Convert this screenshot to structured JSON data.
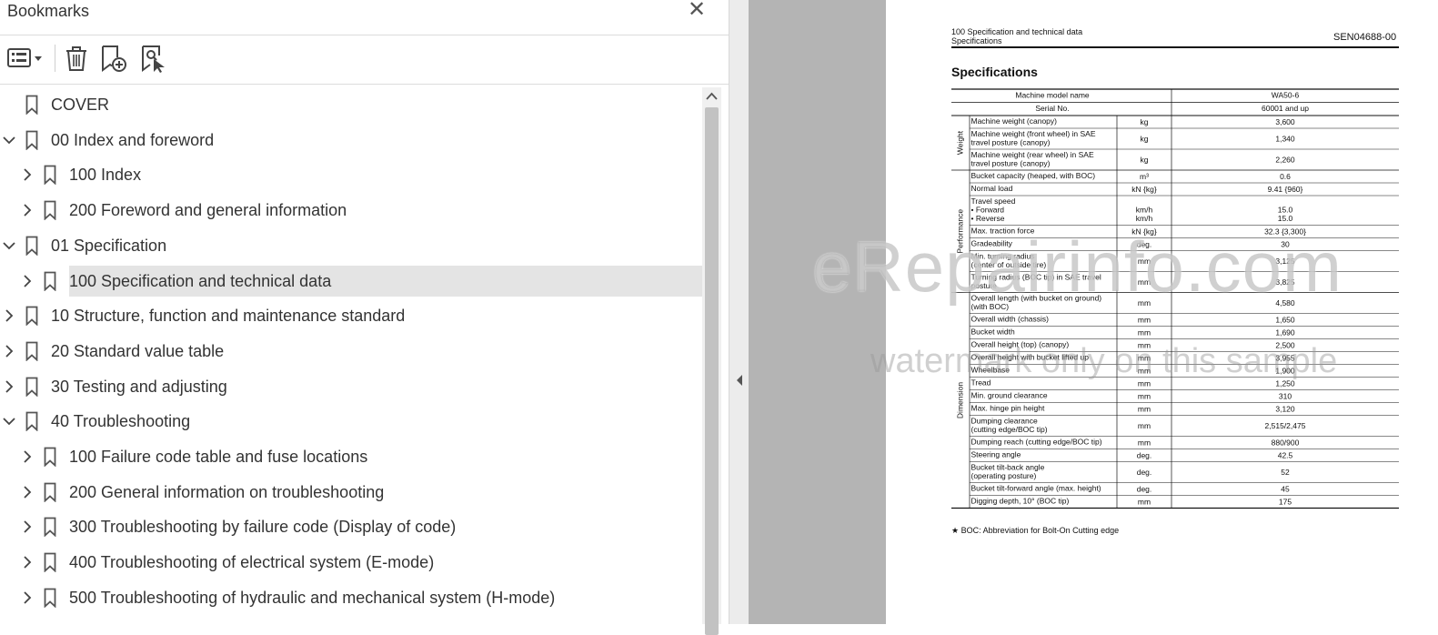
{
  "panel": {
    "title": "Bookmarks",
    "close_label": "✕"
  },
  "toolbar": {
    "options_icon": "options-list-icon",
    "delete_icon": "trash-icon",
    "new_bookmark_icon": "add-bookmark-icon",
    "bookmark_from_selection_icon": "bookmark-search-icon"
  },
  "bookmarks": [
    {
      "label": "COVER",
      "level": 0,
      "expander": "none",
      "selected": false
    },
    {
      "label": "00 Index and foreword",
      "level": 0,
      "expander": "expanded",
      "selected": false
    },
    {
      "label": "100 Index",
      "level": 1,
      "expander": "collapsed",
      "selected": false
    },
    {
      "label": "200 Foreword and general information",
      "level": 1,
      "expander": "collapsed",
      "selected": false
    },
    {
      "label": "01 Specification",
      "level": 0,
      "expander": "expanded",
      "selected": false
    },
    {
      "label": "100 Specification and technical data",
      "level": 1,
      "expander": "collapsed",
      "selected": true
    },
    {
      "label": "10 Structure, function and maintenance standard",
      "level": 0,
      "expander": "collapsed",
      "selected": false
    },
    {
      "label": "20 Standard value table",
      "level": 0,
      "expander": "collapsed",
      "selected": false
    },
    {
      "label": "30 Testing and adjusting",
      "level": 0,
      "expander": "collapsed",
      "selected": false
    },
    {
      "label": "40 Troubleshooting",
      "level": 0,
      "expander": "expanded",
      "selected": false
    },
    {
      "label": "100 Failure code table and fuse locations",
      "level": 1,
      "expander": "collapsed",
      "selected": false
    },
    {
      "label": "200 General information on troubleshooting",
      "level": 1,
      "expander": "collapsed",
      "selected": false
    },
    {
      "label": "300 Troubleshooting by failure code (Display of code)",
      "level": 1,
      "expander": "collapsed",
      "selected": false
    },
    {
      "label": "400 Troubleshooting of electrical system (E-mode)",
      "level": 1,
      "expander": "collapsed",
      "selected": false
    },
    {
      "label": "500 Troubleshooting of hydraulic and mechanical system (H-mode)",
      "level": 1,
      "expander": "collapsed",
      "selected": false
    }
  ],
  "document": {
    "header_line1": "100 Specification and technical data",
    "header_line2": "Specifications",
    "doc_code": "SEN04688-00",
    "title": "Specifications",
    "table": {
      "model_label": "Machine model name",
      "model_value": "WA50-6",
      "serial_label": "Serial No.",
      "serial_value": "60001 and up",
      "groups": [
        {
          "name": "Weight",
          "rows": [
            {
              "item": [
                "Machine weight (canopy)"
              ],
              "unit": "kg",
              "value": "3,600"
            },
            {
              "item": [
                "Machine weight (front wheel) in SAE",
                "travel posture (canopy)"
              ],
              "unit": "kg",
              "value": "1,340"
            },
            {
              "item": [
                "Machine weight (rear wheel) in SAE",
                "travel posture (canopy)"
              ],
              "unit": "kg",
              "value": "2,260"
            }
          ]
        },
        {
          "name": "Performance",
          "rows": [
            {
              "item": [
                "Bucket capacity (heaped, with BOC)"
              ],
              "unit": "m³",
              "value": "0.6"
            },
            {
              "item": [
                "Normal load"
              ],
              "unit": "kN {kg}",
              "value": "9.41 {960}"
            },
            {
              "item": [
                "Travel speed",
                "•  Forward",
                "•  Reverse"
              ],
              "unit": [
                "",
                "km/h",
                "km/h"
              ],
              "value": [
                "",
                "15.0",
                "15.0"
              ]
            },
            {
              "item": [
                "Max. traction force"
              ],
              "unit": "kN {kg}",
              "value": "32.3 {3,300}"
            },
            {
              "item": [
                "Gradeability"
              ],
              "unit": "deg.",
              "value": "30"
            },
            {
              "item": [
                "Min. turning radius",
                "(center of outside tire)"
              ],
              "unit": "mm",
              "value": "3,125"
            },
            {
              "item": [
                "Turning radius (BOC tip) in SAE travel",
                "posture"
              ],
              "unit": "mm",
              "value": "3,825"
            }
          ]
        },
        {
          "name": "Dimension",
          "rows": [
            {
              "item": [
                "Overall length (with bucket on ground)",
                "(with BOC)"
              ],
              "unit": "mm",
              "value": "4,580"
            },
            {
              "item": [
                "Overall width (chassis)"
              ],
              "unit": "mm",
              "value": "1,650"
            },
            {
              "item": [
                "Bucket width"
              ],
              "unit": "mm",
              "value": "1,690"
            },
            {
              "item": [
                "Overall height (top) (canopy)"
              ],
              "unit": "mm",
              "value": "2,500"
            },
            {
              "item": [
                "Overall height with bucket lifted up"
              ],
              "unit": "mm",
              "value": "3,955"
            },
            {
              "item": [
                "Wheelbase"
              ],
              "unit": "mm",
              "value": "1,900"
            },
            {
              "item": [
                "Tread"
              ],
              "unit": "mm",
              "value": "1,250"
            },
            {
              "item": [
                "Min. ground clearance"
              ],
              "unit": "mm",
              "value": "310"
            },
            {
              "item": [
                "Max. hinge pin height"
              ],
              "unit": "mm",
              "value": "3,120"
            },
            {
              "item": [
                "Dumping clearance",
                "(cutting edge/BOC tip)"
              ],
              "unit": "mm",
              "value": "2,515/2,475"
            },
            {
              "item": [
                "Dumping reach (cutting edge/BOC tip)"
              ],
              "unit": "mm",
              "value": "880/900"
            },
            {
              "item": [
                "Steering angle"
              ],
              "unit": "deg.",
              "value": "42.5"
            },
            {
              "item": [
                "Bucket tilt-back angle",
                "(operating posture)"
              ],
              "unit": "deg.",
              "value": "52"
            },
            {
              "item": [
                "Bucket tilt-forward angle (max. height)"
              ],
              "unit": "deg.",
              "value": "45"
            },
            {
              "item": [
                "Digging depth, 10° (BOC tip)"
              ],
              "unit": "mm",
              "value": "175"
            }
          ]
        }
      ]
    },
    "note": "★  BOC: Abbreviation for Bolt-On Cutting edge"
  },
  "watermark": {
    "line1": "eRepairinfo.com",
    "line2": "watermark only on this sample"
  }
}
